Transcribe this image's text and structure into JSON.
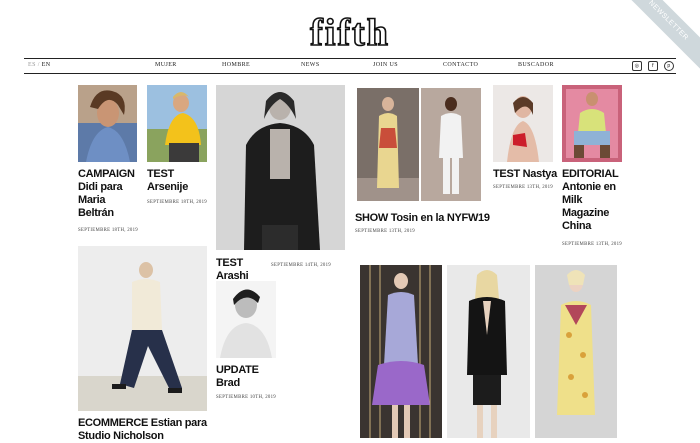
{
  "brand": {
    "logo_text": "fifth",
    "newsletter_label": "NEWSLETTER"
  },
  "nav": {
    "lang_es": "ES",
    "lang_sep": "/",
    "lang_en": "EN",
    "items": [
      "MUJER",
      "HOMBRE",
      "NEWS",
      "JOIN US",
      "CONTACTO",
      "BUSCADOR"
    ],
    "social_icons": [
      "instagram-icon",
      "facebook-icon",
      "pinterest-icon"
    ]
  },
  "posts": [
    {
      "title": "CAMPAIGN Didi para Maria Beltrán",
      "lines": [
        "CAMPAIGN",
        "Didi para",
        "Maria",
        "Beltrán"
      ],
      "date": "SEPTIEMBRE 18TH, 2019"
    },
    {
      "title": "TEST Arsenije",
      "lines": [
        "TEST",
        "Arsenije"
      ],
      "date": "SEPTIEMBRE 18TH, 2019"
    },
    {
      "title": "TEST Arashi",
      "date": "SEPTIEMBRE 14TH, 2019"
    },
    {
      "title": "SHOW Tosin en la NYFW19",
      "date": "SEPTIEMBRE 13TH, 2019"
    },
    {
      "title": "TEST Nastya",
      "date": "SEPTIEMBRE 13TH, 2019"
    },
    {
      "title": "EDITORIAL Antonie en Milk Magazine China",
      "lines": [
        "EDITORIAL",
        "Antonie en",
        "Milk",
        "Magazine",
        "China"
      ],
      "date": "SEPTIEMBRE 13TH, 2019"
    },
    {
      "title": "ECOMMERCE Estian para Studio Nicholson",
      "lines": [
        "ECOMMERCE Estian para",
        "Studio Nicholson"
      ]
    },
    {
      "title": "UPDATE Brad",
      "lines": [
        "UPDATE",
        "Brad"
      ],
      "date": "SEPTIEMBRE 10TH, 2019"
    }
  ],
  "colors": {
    "text": "#111111",
    "ribbon": "#cfd8dc",
    "rule": "#222222"
  }
}
